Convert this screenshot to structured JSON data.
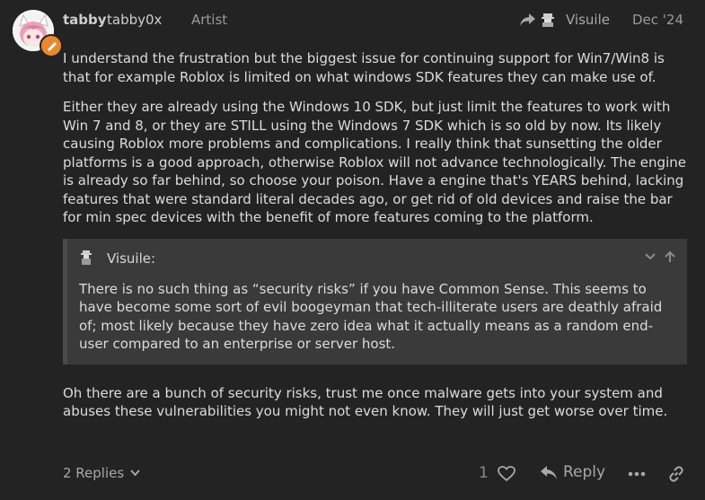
{
  "post": {
    "author": {
      "username": "tabby",
      "full_name": "tabby0x",
      "title": "Artist",
      "avatar_icon": "anime-avatar",
      "flair_icon": "brush-icon"
    },
    "reply_to": {
      "icon": "share-arrow-icon",
      "name": "Visuile"
    },
    "date": "Dec '24",
    "paragraphs": [
      "I understand the frustration but the biggest issue for continuing support for Win7/Win8 is that for example Roblox is limited on what windows SDK features they can make use of.",
      "Either they are already using the Windows 10 SDK, but just limit the features to work with Win 7 and 8, or they are STILL using the Windows 7 SDK which is so old by now. Its likely causing Roblox more problems and complications. I really think that sunsetting the older platforms is a good approach, otherwise Roblox will not advance technologically. The engine is already so far behind, so choose your poison. Have a engine that's YEARS behind, lacking features that were standard literal decades ago, or get rid of old devices and raise the bar for min spec devices with the benefit of more features coming to the platform."
    ],
    "quote": {
      "author": "Visuile:",
      "text": "There is no such thing as “security risks” if you have Common Sense. This seems to have become some sort of evil boogeyman that tech-illiterate users are deathly afraid of; most likely because they have zero idea what it actually means as a random end-user compared to an enterprise or server host."
    },
    "closing": "Oh there are a bunch of security risks, trust me once malware gets into your system and abuses these vulnerabilities you might not even know. They will just get worse over time.",
    "footer": {
      "replies_label": "2 Replies",
      "like_count": "1",
      "reply_label": "Reply"
    }
  },
  "colors": {
    "background": "#232323",
    "quote_background": "#3a3a3a",
    "text": "#dcdcdc",
    "muted": "#a8a8a8",
    "flair": "#e8892f"
  }
}
